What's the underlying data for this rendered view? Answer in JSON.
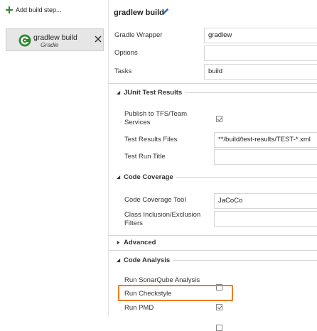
{
  "left_panel": {
    "add_step_label": "Add build step...",
    "task": {
      "title": "gradlew build",
      "subtitle": "Gradle",
      "icon": "gradle-icon"
    }
  },
  "header": {
    "title": "gradlew build",
    "edit_icon": "pencil-icon"
  },
  "fields": {
    "gradle_wrapper": {
      "label": "Gradle Wrapper",
      "value": "gradlew"
    },
    "options": {
      "label": "Options",
      "value": ""
    },
    "tasks": {
      "label": "Tasks",
      "value": "build"
    }
  },
  "junit": {
    "title": "JUnit Test Results",
    "publish": {
      "label": "Publish to TFS/Team Services",
      "checked": true
    },
    "results_files": {
      "label": "Test Results Files",
      "value": "**/build/test-results/TEST-*.xml"
    },
    "run_title": {
      "label": "Test Run Title",
      "value": ""
    }
  },
  "coverage": {
    "title": "Code Coverage",
    "tool": {
      "label": "Code Coverage Tool",
      "value": "JaCoCo"
    },
    "filters": {
      "label": "Class Inclusion/Exclusion Filters",
      "value": ""
    }
  },
  "advanced": {
    "title": "Advanced"
  },
  "analysis": {
    "title": "Code Analysis",
    "sonarqube": {
      "label": "Run SonarQube Analysis",
      "checked": false
    },
    "checkstyle": {
      "label": "Run Checkstyle",
      "checked": true
    },
    "pmd": {
      "label": "Run PMD",
      "checked": false
    }
  },
  "colors": {
    "highlight": "#ef7d22",
    "accent_green": "#2f8a2f",
    "pencil_blue": "#1e6fd6"
  }
}
